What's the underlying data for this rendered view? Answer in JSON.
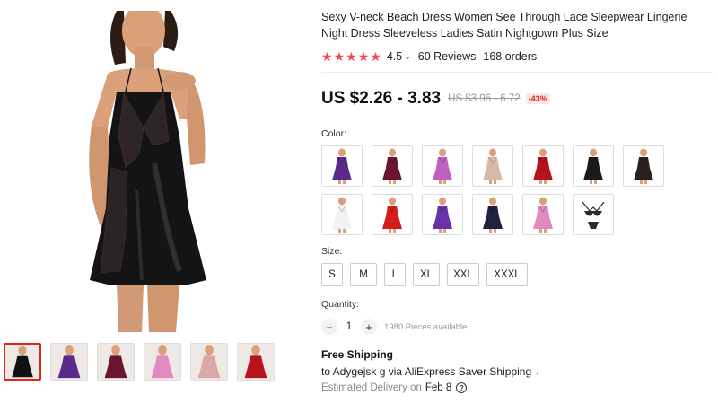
{
  "product": {
    "title": "Sexy V-neck Beach Dress Women See Through Lace Sleepwear Lingerie Night Dress Sleeveless Ladies Satin Nightgown Plus Size",
    "rating": "4.5",
    "rating_chevron": "⌄",
    "reviews": "60 Reviews",
    "orders": "168 orders",
    "star_color": "#f5484e"
  },
  "price": {
    "current": "US $2.26 - 3.83",
    "original": "US $3.96 - 6.72",
    "discount": "-43%"
  },
  "color": {
    "label": "Color:",
    "swatches": [
      {
        "name": "purple",
        "color": "#5a2a8a"
      },
      {
        "name": "wine",
        "color": "#6b1530"
      },
      {
        "name": "pink-purple",
        "color": "#c060c0"
      },
      {
        "name": "skin",
        "color": "#d9b8a8"
      },
      {
        "name": "red",
        "color": "#b5121b"
      },
      {
        "name": "black",
        "color": "#1a1a1a"
      },
      {
        "name": "black-lace",
        "color": "#2a2020"
      },
      {
        "name": "white",
        "color": "#f2f2f2"
      },
      {
        "name": "bright-red",
        "color": "#d41c1c"
      },
      {
        "name": "violet",
        "color": "#6a32a8"
      },
      {
        "name": "navy",
        "color": "#1d2340"
      },
      {
        "name": "pink",
        "color": "#e08ac0"
      },
      {
        "name": "black-set",
        "color": "#2a2a2a"
      }
    ]
  },
  "size": {
    "label": "Size:",
    "options": [
      "S",
      "M",
      "L",
      "XL",
      "XXL",
      "XXXL"
    ]
  },
  "quantity": {
    "label": "Quantity:",
    "minus": "−",
    "plus": "+",
    "value": "1",
    "available": "1980 Pieces available"
  },
  "shipping": {
    "title": "Free Shipping",
    "line": "to Adygejsk g via AliExpress Saver Shipping",
    "chevron": "⌄",
    "delivery_prefix": "Estimated Delivery on",
    "delivery_date": "Feb 8",
    "help": "?"
  },
  "gallery": {
    "thumbnail_colors": [
      "#111111",
      "#5a2a8a",
      "#6b1530",
      "#e08ac0",
      "#d9a8a8",
      "#b5121b"
    ]
  }
}
